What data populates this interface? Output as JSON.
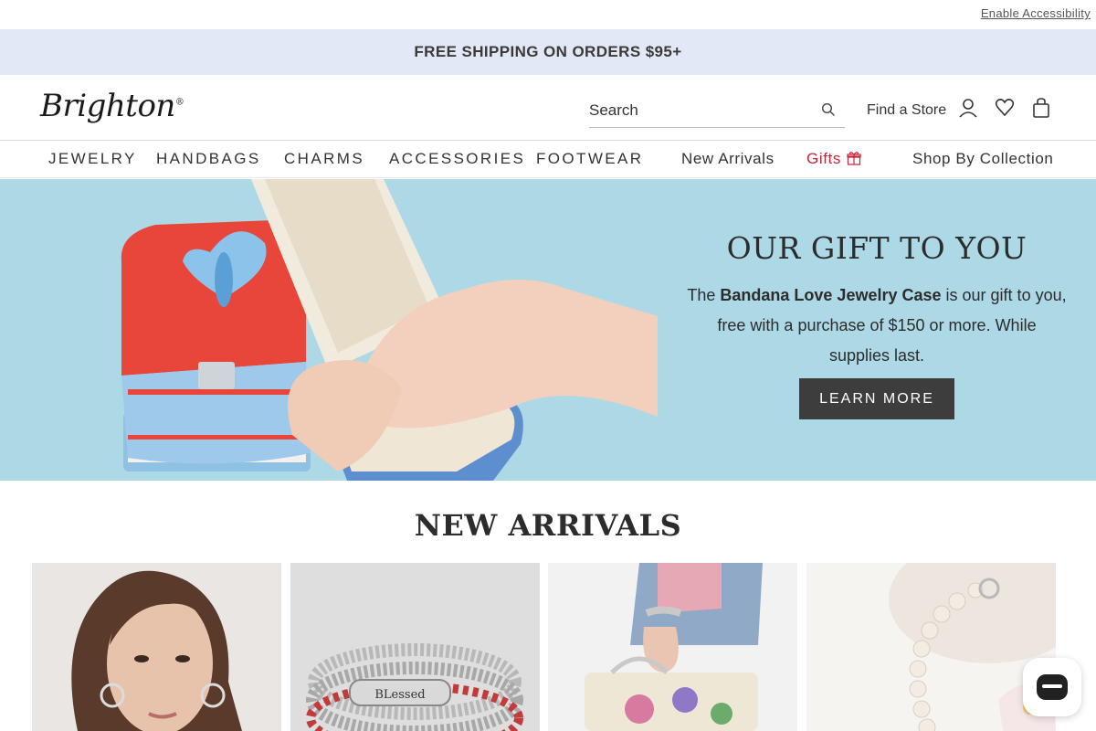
{
  "utility": {
    "accessibility_link": "Enable Accessibility"
  },
  "promo": {
    "text": "FREE SHIPPING ON ORDERS $95+"
  },
  "header": {
    "logo": "Brighton",
    "logo_mark": "®",
    "search_placeholder": "Search",
    "find_store": "Find a Store",
    "icons": [
      "search-icon",
      "account-icon",
      "wishlist-heart-icon",
      "shopping-bag-icon"
    ]
  },
  "nav": {
    "items": [
      "JEWELRY",
      "HANDBAGS",
      "CHARMS",
      "ACCESSORIES",
      "FOOTWEAR",
      "New Arrivals",
      "Gifts",
      "Shop By Collection"
    ],
    "highlight_color": "#c8223a"
  },
  "hero": {
    "title": "OUR GIFT TO YOU",
    "text_prefix": "The ",
    "text_bold": "Bandana Love Jewelry Case",
    "text_suffix": " is our gift to you, free with a purchase of $150 or more. While supplies last.",
    "button": "LEARN MORE",
    "background": "#add8e6"
  },
  "new_arrivals": {
    "title": "NEW ARRIVALS",
    "products": [
      {
        "name": "product-hoop-earrings-model"
      },
      {
        "name": "product-blessed-bracelet-stack",
        "engraving": "BLessed"
      },
      {
        "name": "product-handbag-bangle"
      },
      {
        "name": "product-pearl-bracelet"
      }
    ]
  },
  "chat": {
    "icon": "chat-bubble-icon"
  }
}
